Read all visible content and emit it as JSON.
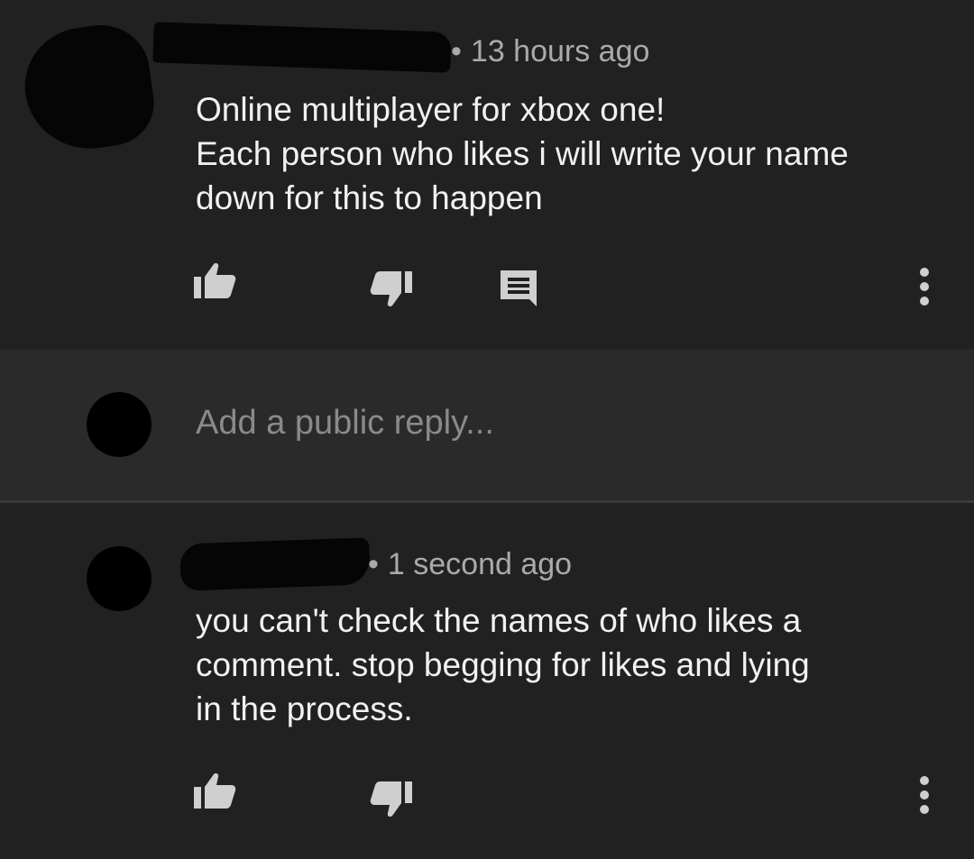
{
  "comments": [
    {
      "author_redacted": true,
      "timestamp": "13 hours ago",
      "text_lines": [
        "Online multiplayer for xbox one!",
        "Each person who likes i will write your name",
        "down for this to happen"
      ],
      "actions": [
        "like-icon",
        "dislike-icon",
        "reply-icon",
        "more-icon"
      ]
    },
    {
      "author_redacted": true,
      "timestamp": "1 second ago",
      "text_lines": [
        "you can't check the names of who likes a",
        "comment. stop begging for likes and lying",
        "in the process."
      ],
      "actions": [
        "like-icon",
        "dislike-icon",
        "more-icon"
      ]
    }
  ],
  "reply_box": {
    "placeholder": "Add a public reply..."
  },
  "meta_separator": "•",
  "colors": {
    "background": "#212121",
    "reply_background": "#2a2a2a",
    "text": "#f1f1f1",
    "secondary_text": "#aaaaaa",
    "icon": "#cfcfcf"
  }
}
